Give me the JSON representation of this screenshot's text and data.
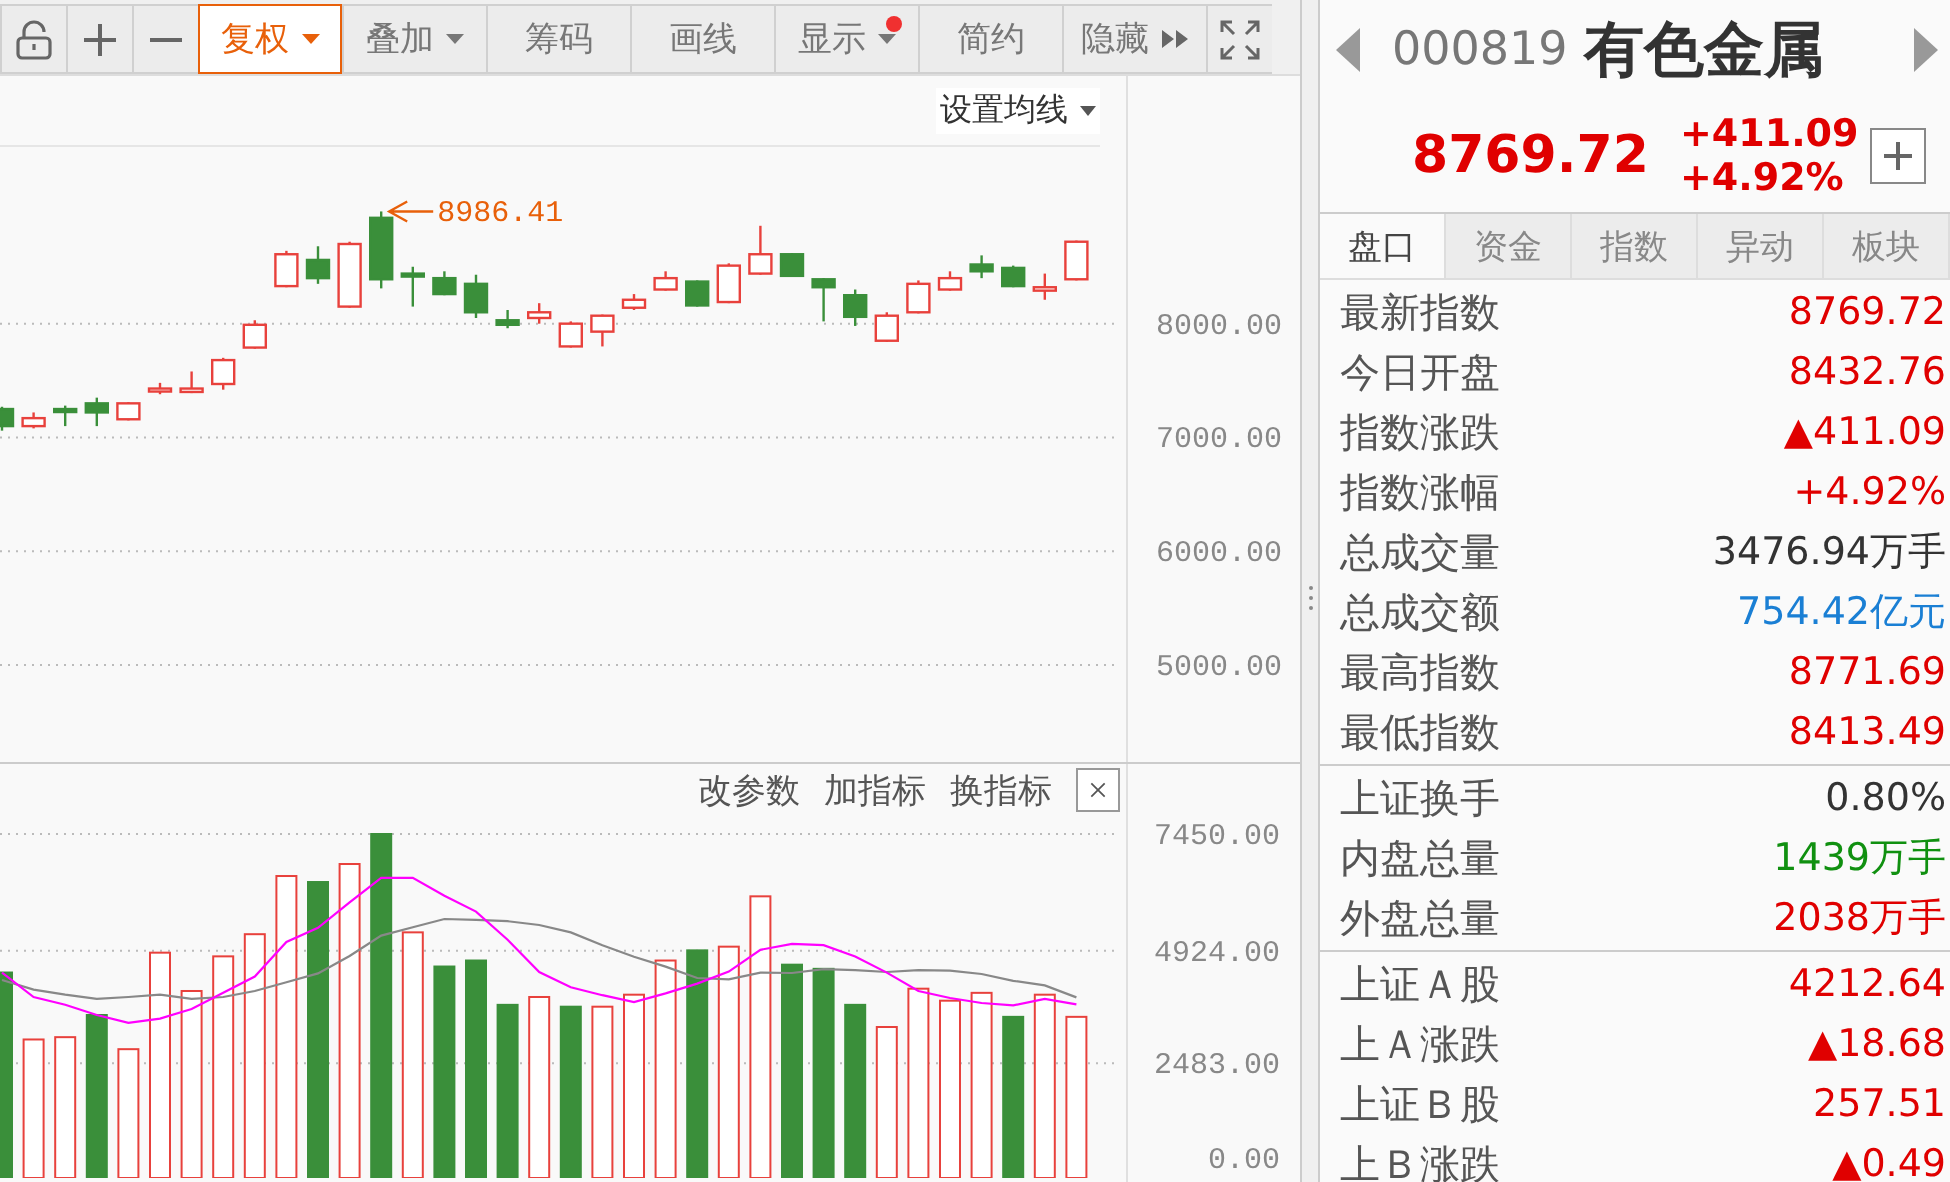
{
  "toolbar": [
    {
      "kind": "lock",
      "selected": false
    },
    {
      "kind": "plus",
      "selected": false
    },
    {
      "kind": "minus",
      "selected": false
    },
    {
      "kind": "text",
      "label": "复权",
      "selected": true,
      "caret": true,
      "notification": false,
      "more": false
    },
    {
      "kind": "text",
      "label": "叠加",
      "selected": false,
      "caret": true,
      "notification": false,
      "more": false
    },
    {
      "kind": "text",
      "label": "筹码",
      "selected": false,
      "caret": false,
      "notification": false,
      "more": false
    },
    {
      "kind": "text",
      "label": "画线",
      "selected": false,
      "caret": false,
      "notification": false,
      "more": false
    },
    {
      "kind": "text",
      "label": "显示",
      "selected": false,
      "caret": true,
      "notification": true,
      "more": false
    },
    {
      "kind": "text",
      "label": "简约",
      "selected": false,
      "caret": false,
      "notification": false,
      "more": false
    },
    {
      "kind": "text",
      "label": "隐藏",
      "selected": false,
      "caret": false,
      "notification": false,
      "more": true
    },
    {
      "kind": "fullscreen",
      "selected": false
    }
  ],
  "price_chart": {
    "ma_settings": "设置均线",
    "chart_data": {
      "type": "candlestick",
      "grid": true,
      "ylim": [
        4140,
        9561
      ],
      "yticks": [
        {
          "value": 8000,
          "label": "8000.00"
        },
        {
          "value": 7000,
          "label": "7000.00"
        },
        {
          "value": 6000,
          "label": "6000.00"
        },
        {
          "value": 5000,
          "label": "5000.00"
        }
      ],
      "ohlc": [
        [
          7250,
          7270,
          7060,
          7100
        ],
        [
          7100,
          7220,
          7080,
          7170
        ],
        [
          7250,
          7280,
          7100,
          7240
        ],
        [
          7300,
          7350,
          7100,
          7220
        ],
        [
          7160,
          7310,
          7150,
          7300
        ],
        [
          7410,
          7480,
          7380,
          7430
        ],
        [
          7400,
          7580,
          7390,
          7430
        ],
        [
          7470,
          7700,
          7420,
          7680
        ],
        [
          7790,
          8030,
          7780,
          7990
        ],
        [
          8330,
          8640,
          8320,
          8610
        ],
        [
          8560,
          8680,
          8350,
          8400
        ],
        [
          8150,
          8720,
          8140,
          8700
        ],
        [
          8930,
          8986,
          8310,
          8390
        ],
        [
          8440,
          8500,
          8150,
          8430
        ],
        [
          8400,
          8460,
          8250,
          8260
        ],
        [
          8350,
          8430,
          8050,
          8100
        ],
        [
          8030,
          8120,
          7960,
          7990
        ],
        [
          8050,
          8180,
          8000,
          8100
        ],
        [
          7800,
          8020,
          7790,
          8000
        ],
        [
          7930,
          8080,
          7800,
          8070
        ],
        [
          8140,
          8260,
          8120,
          8210
        ],
        [
          8300,
          8460,
          8290,
          8400
        ],
        [
          8370,
          8380,
          8150,
          8160
        ],
        [
          8190,
          8530,
          8180,
          8510
        ],
        [
          8440,
          8860,
          8430,
          8610
        ],
        [
          8610,
          8620,
          8410,
          8420
        ],
        [
          8390,
          8400,
          8020,
          8320
        ],
        [
          8250,
          8300,
          7980,
          8060
        ],
        [
          7850,
          8100,
          7840,
          8070
        ],
        [
          8100,
          8380,
          8090,
          8350
        ],
        [
          8300,
          8460,
          8290,
          8400
        ],
        [
          8520,
          8600,
          8400,
          8460
        ],
        [
          8490,
          8510,
          8320,
          8330
        ],
        [
          8290,
          8440,
          8210,
          8320
        ],
        [
          8390,
          8730,
          8380,
          8720
        ]
      ],
      "annotations": [
        {
          "text": "8986.41"
        }
      ]
    }
  },
  "volume_panel": {
    "actions": [
      "改参数",
      "加指标",
      "换指标"
    ],
    "chart_data": {
      "type": "bar",
      "grid": true,
      "ylim": [
        0,
        7450
      ],
      "yticks": [
        {
          "value": 7450,
          "label": "7450.00"
        },
        {
          "value": 4924,
          "label": "4924.00"
        },
        {
          "value": 2483,
          "label": "2483.00"
        },
        {
          "value": 0,
          "label": "0.00"
        }
      ],
      "series": [
        {
          "color": "#e8413c",
          "values": [
            null,
            3000,
            3050,
            null,
            2790,
            4880,
            4050,
            4800,
            5280,
            6540,
            null,
            6800,
            null,
            5320,
            null,
            null,
            null,
            3920,
            null,
            3710,
            3970,
            4710,
            null,
            5010,
            6100,
            null,
            null,
            null,
            3270,
            4100,
            3840,
            4010,
            null,
            3970,
            3490
          ]
        },
        {
          "color": "#3a8f3a",
          "values": [
            4450,
            null,
            null,
            3530,
            null,
            null,
            null,
            null,
            null,
            null,
            6410,
            null,
            7450,
            null,
            4580,
            4710,
            3750,
            null,
            3710,
            null,
            null,
            null,
            4930,
            null,
            null,
            4620,
            4530,
            3750,
            null,
            null,
            null,
            null,
            3490,
            null,
            null
          ]
        }
      ]
    }
  },
  "moving_averages": {
    "chart_data": {
      "type": "line",
      "ylim": [
        0,
        7450
      ],
      "series": [
        {
          "color": "#888888",
          "values": [
            4290,
            4080,
            3970,
            3880,
            3920,
            3970,
            3880,
            3920,
            4050,
            4240,
            4430,
            4810,
            5250,
            5430,
            5610,
            5590,
            5560,
            5480,
            5320,
            5040,
            4790,
            4580,
            4330,
            4300,
            4450,
            4440,
            4520,
            4500,
            4460,
            4500,
            4490,
            4420,
            4270,
            4170,
            3910
          ]
        },
        {
          "color": "#ff00ff",
          "values": [
            4450,
            3920,
            3750,
            3530,
            3360,
            3450,
            3660,
            4010,
            4360,
            5110,
            5420,
            5970,
            6500,
            6500,
            6110,
            5770,
            5160,
            4460,
            4130,
            3960,
            3810,
            4000,
            4210,
            4470,
            4940,
            5070,
            5040,
            4800,
            4450,
            4050,
            3900,
            3790,
            3740,
            3880,
            3760
          ]
        }
      ]
    }
  },
  "quote": {
    "code": "000819",
    "name": "有色金属",
    "price": "8769.72",
    "change": "+411.09",
    "change_pct": "+4.92%"
  },
  "tabs": [
    {
      "label": "盘口",
      "selected": true
    },
    {
      "label": "资金",
      "selected": false
    },
    {
      "label": "指数",
      "selected": false
    },
    {
      "label": "异动",
      "selected": false
    },
    {
      "label": "板块",
      "selected": false
    }
  ],
  "groups": [
    [
      {
        "label": "最新指数",
        "value": "8769.72",
        "color": "#e00000"
      },
      {
        "label": "今日开盘",
        "value": "8432.76",
        "color": "#e00000"
      },
      {
        "label": "指数涨跌",
        "value": "▲411.09",
        "color": "#e00000"
      },
      {
        "label": "指数涨幅",
        "value": "+4.92%",
        "color": "#e00000"
      },
      {
        "label": "总成交量",
        "value": "3476.94万手",
        "color": "#333333"
      },
      {
        "label": "总成交额",
        "value": "754.42亿元",
        "color": "#1a7fd4"
      },
      {
        "label": "最高指数",
        "value": "8771.69",
        "color": "#e00000"
      },
      {
        "label": "最低指数",
        "value": "8413.49",
        "color": "#e00000"
      }
    ],
    [
      {
        "label": "上证换手",
        "value": "0.80%",
        "color": "#333333"
      },
      {
        "label": "内盘总量",
        "value": "1439万手",
        "color": "#109010"
      },
      {
        "label": "外盘总量",
        "value": "2038万手",
        "color": "#e00000"
      }
    ],
    [
      {
        "label": "上证Ａ股",
        "value": "4212.64",
        "color": "#e00000"
      },
      {
        "label": "上Ａ涨跌",
        "value": "▲18.68",
        "color": "#e00000"
      },
      {
        "label": "上证Ｂ股",
        "value": "257.51",
        "color": "#e00000"
      },
      {
        "label": "上Ｂ涨跌",
        "value": "▲0.49",
        "color": "#e00000"
      }
    ]
  ]
}
